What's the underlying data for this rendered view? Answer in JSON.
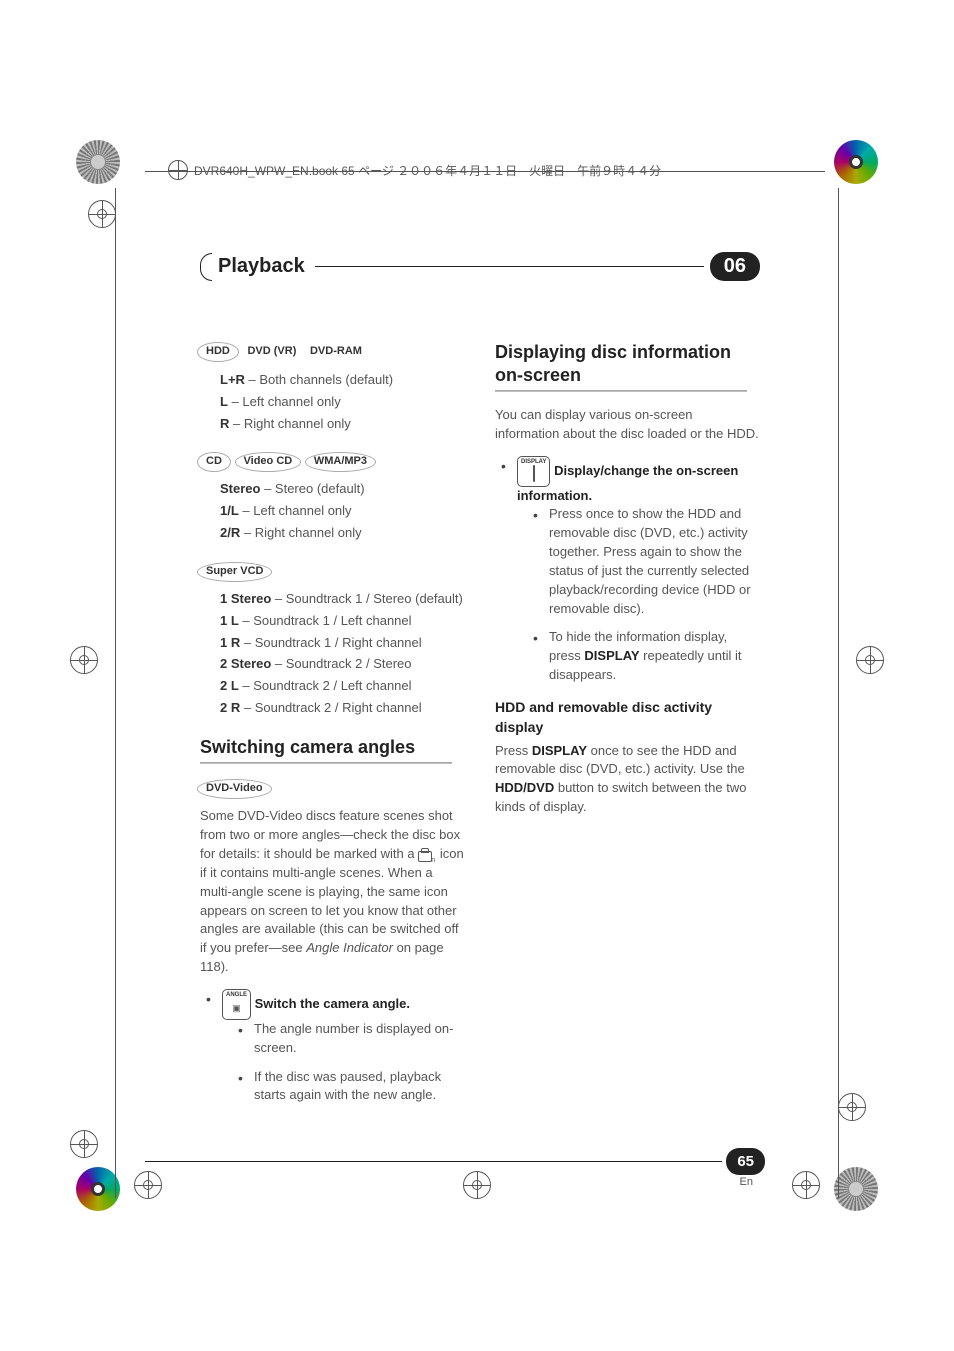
{
  "header_meta": "DVR640H_WPW_EN.book  65 ページ  ２００６年４月１１日　火曜日　午前９時４４分",
  "chapter": {
    "title": "Playback",
    "number": "06"
  },
  "page": {
    "number": "65",
    "lang": "En"
  },
  "grp1_badges": [
    "HDD",
    "DVD (VR)",
    "DVD-RAM"
  ],
  "grp1_opts": [
    {
      "k": "L+R",
      "v": " – Both channels (default)"
    },
    {
      "k": "L",
      "v": " – Left channel only"
    },
    {
      "k": "R",
      "v": " – Right channel only"
    }
  ],
  "grp2_badges": [
    "CD",
    "Video CD",
    "WMA/MP3"
  ],
  "grp2_opts": [
    {
      "k": "Stereo",
      "v": " – Stereo (default)"
    },
    {
      "k": "1/L",
      "v": " – Left channel only"
    },
    {
      "k": "2/R",
      "v": " – Right channel only"
    }
  ],
  "grp3_badge": "Super VCD",
  "grp3_opts": [
    {
      "k": "1 Stereo",
      "v": " – Soundtrack 1 / Stereo (default)"
    },
    {
      "k": "1 L",
      "v": " – Soundtrack 1 / Left channel"
    },
    {
      "k": "1 R",
      "v": " – Soundtrack 1 / Right channel"
    },
    {
      "k": "2 Stereo",
      "v": " – Soundtrack 2 / Stereo"
    },
    {
      "k": "2 L",
      "v": " – Soundtrack 2 / Left channel"
    },
    {
      "k": "2 R",
      "v": " – Soundtrack 2 / Right channel"
    }
  ],
  "angles": {
    "heading": "Switching camera angles",
    "badge": "DVD-Video",
    "para1a": "Some DVD-Video discs feature scenes shot from two or more angles—check the disc box for details: it should be marked with a ",
    "para1b": " icon if it contains multi-angle scenes. When a multi-angle scene is playing, the same icon appears on screen to let you know that other angles are available (this can be switched off if you prefer—see ",
    "para1_ital": "Angle Indicator",
    "para1c": " on page 118).",
    "btn_label": "ANGLE",
    "step_title": " Switch the camera angle.",
    "sub1": "The angle number is displayed on-screen.",
    "sub2": "If the disc was paused, playback starts again with the new angle."
  },
  "disc": {
    "heading": "Displaying disc information on-screen",
    "intro": "You can display various on-screen information about the disc loaded or the HDD.",
    "btn_label": "DISPLAY",
    "step_title": " Display/change the on-screen information.",
    "b1": "Press once to show the HDD and removable disc (DVD, etc.) activity together. Press again to show the status of just the currently selected playback/recording device (HDD or removable disc).",
    "b2a": "To hide the information display, press ",
    "b2_bold": "DISPLAY",
    "b2b": " repeatedly until it disappears.",
    "sub_heading": "HDD and removable disc activity display",
    "p2a": "Press ",
    "p2_bold1": "DISPLAY",
    "p2b": " once to see the HDD and removable disc (DVD, etc.) activity. Use the ",
    "p2_bold2": "HDD/DVD",
    "p2c": " button to switch between the two kinds of display."
  }
}
